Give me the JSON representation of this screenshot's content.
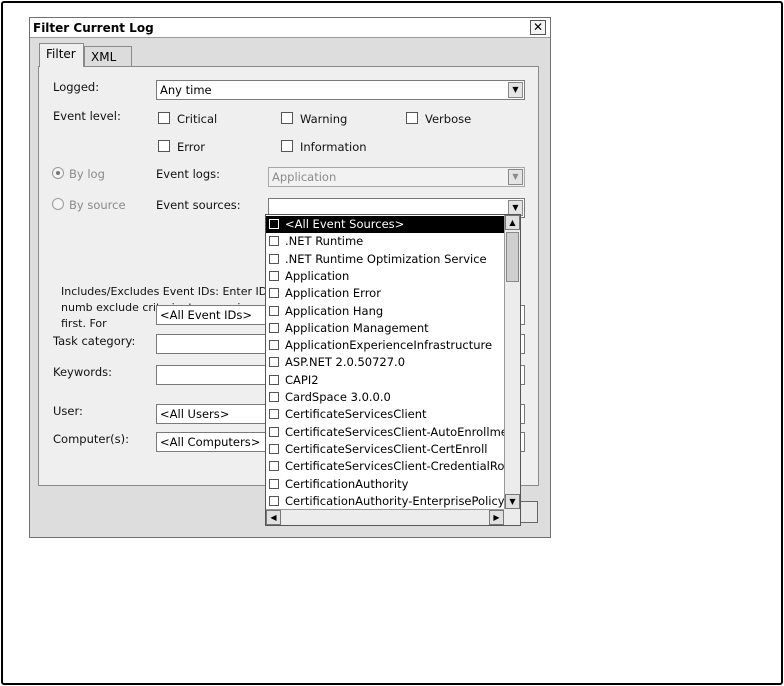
{
  "dialog": {
    "title": "Filter Current Log",
    "close_glyph": "✕"
  },
  "tabs": [
    {
      "label": "Filter"
    },
    {
      "label": "XML"
    }
  ],
  "logged": {
    "label": "Logged:",
    "value": "Any time"
  },
  "event_level": {
    "label": "Event level:",
    "options": [
      {
        "label": "Critical"
      },
      {
        "label": "Warning"
      },
      {
        "label": "Verbose"
      },
      {
        "label": "Error"
      },
      {
        "label": "Information"
      }
    ]
  },
  "by_log": {
    "label": "By log",
    "event_logs_label": "Event logs:",
    "event_logs_value": "Application"
  },
  "by_source": {
    "label": "By source",
    "event_sources_label": "Event sources:",
    "event_sources_value": ""
  },
  "event_ids": {
    "description": "Includes/Excludes Event IDs: Enter ID numb exclude criteria, type a minus sign first. For",
    "value": "<All Event IDs>"
  },
  "task_category": {
    "label": "Task category:",
    "value": ""
  },
  "keywords": {
    "label": "Keywords:",
    "value": ""
  },
  "user": {
    "label": "User:",
    "value": "<All Users>"
  },
  "computers": {
    "label": "Computer(s):",
    "value": "<All Computers>"
  },
  "source_list": {
    "items": [
      "<All Event Sources>",
      ".NET Runtime",
      ".NET Runtime Optimization Service",
      "Application",
      "Application Error",
      "Application Hang",
      "Application Management",
      "ApplicationExperienceInfrastructure",
      "ASP.NET 2.0.50727.0",
      "CAPI2",
      "CardSpace 3.0.0.0",
      "CertificateServicesClient",
      "CertificateServicesClient-AutoEnrollment",
      "CertificateServicesClient-CertEnroll",
      "CertificateServicesClient-CredentialRoaming",
      "CertificationAuthority",
      "CertificationAuthority-EnterprisePolicy"
    ],
    "selected_index": 0
  },
  "scroll": {
    "up": "▲",
    "down": "▼",
    "left": "◀",
    "right": "▶"
  },
  "dropdown_glyph": "▼"
}
